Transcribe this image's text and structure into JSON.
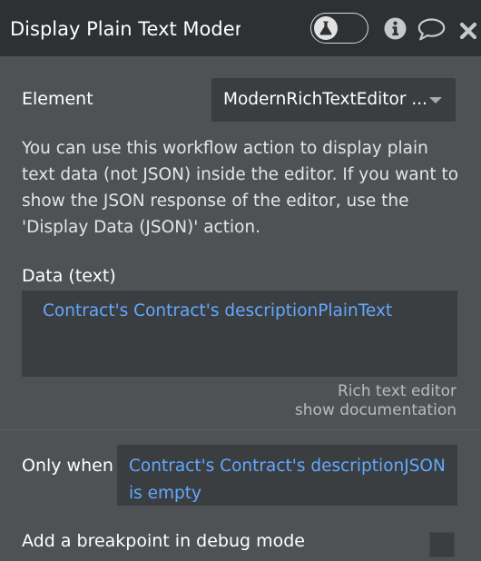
{
  "header": {
    "title": "Display Plain Text ModernRichTextEditor",
    "toggle_icon": "flask-icon",
    "info_icon": "info-icon",
    "comment_icon": "comment-icon",
    "close_icon": "close-icon"
  },
  "element": {
    "label": "Element",
    "value": "ModernRichTextEditor ..."
  },
  "description": "You can use this workflow action to display plain text data (not JSON) inside the editor. If you want to show the JSON response of the editor, use the 'Display Data (JSON)' action.",
  "data_text": {
    "label": "Data (text)",
    "value": "Contract's Contract's descriptionPlainText"
  },
  "plugin": {
    "name": "Rich text editor",
    "doc_link": "show documentation"
  },
  "only_when": {
    "label": "Only when",
    "value": "Contract's Contract's descriptionJSON is empty"
  },
  "breakpoint": {
    "label": "Add a breakpoint in debug mode",
    "checked": false
  },
  "colors": {
    "header_bg": "#2d3134",
    "panel_bg": "#4f5254",
    "field_bg": "#3b3e40",
    "dynamic_text": "#62a8ff"
  }
}
